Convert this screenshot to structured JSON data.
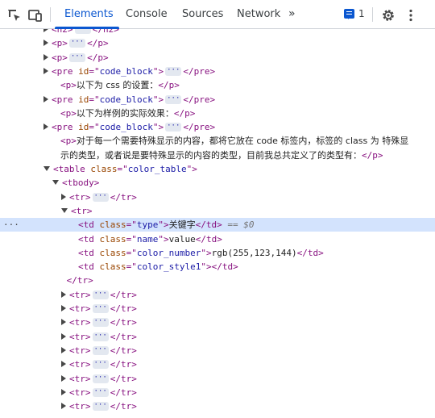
{
  "toolbar": {
    "inspect_icon": "element-picker-icon",
    "device_icon": "device-toolbar-icon",
    "tabs": [
      {
        "label": "Elements",
        "active": true
      },
      {
        "label": "Console",
        "active": false
      },
      {
        "label": "Sources",
        "active": false
      },
      {
        "label": "Network",
        "active": false
      }
    ],
    "more_tabs": "»",
    "issues_count": "1",
    "settings_icon": "gear-icon",
    "menu_icon": "kebab-menu-icon"
  },
  "tree": {
    "rows": [
      {
        "indent": 0,
        "tri": "collapsed",
        "html": "<span class='tag'>&lt;h2&gt;</span>{…}<span class='tag'>&lt;/h2&gt;</span>"
      },
      {
        "indent": 0,
        "tri": "collapsed",
        "html": "<span class='tag'>&lt;p&gt;</span>{…}<span class='tag'>&lt;/p&gt;</span>"
      },
      {
        "indent": 0,
        "tri": "collapsed",
        "html": "<span class='tag'>&lt;p&gt;</span>{…}<span class='tag'>&lt;/p&gt;</span>"
      },
      {
        "indent": 0,
        "tri": "collapsed",
        "html": "<span class='tag'>&lt;pre </span><span class='attr'>id</span><span class='tag'>=\"</span><span class='val'>code_block</span><span class='tag'>\"&gt;</span>{…}<span class='tag'>&lt;/pre&gt;</span>"
      },
      {
        "indent": 1,
        "tri": "none",
        "html": "<span class='tag'>&lt;p&gt;</span><span class='txt'>以下为 css 的设置：</span><span class='tag'>&lt;/p&gt;</span>"
      },
      {
        "indent": 0,
        "tri": "collapsed",
        "html": "<span class='tag'>&lt;pre </span><span class='attr'>id</span><span class='tag'>=\"</span><span class='val'>code_block</span><span class='tag'>\"&gt;</span>{…}<span class='tag'>&lt;/pre&gt;</span>"
      },
      {
        "indent": 1,
        "tri": "none",
        "html": "<span class='tag'>&lt;p&gt;</span><span class='txt'>以下为样例的实际效果：</span><span class='tag'>&lt;/p&gt;</span>"
      },
      {
        "indent": 0,
        "tri": "collapsed",
        "html": "<span class='tag'>&lt;pre </span><span class='attr'>id</span><span class='tag'>=\"</span><span class='val'>code_block</span><span class='tag'>\"&gt;</span>{…}<span class='tag'>&lt;/pre&gt;</span>"
      },
      {
        "indent": 1,
        "tri": "none",
        "html": "<span class='tag'>&lt;p&gt;</span><span class='txt'>对于每一个需要特殊显示的内容，都将它放在 code 标签内，标签的 class 为 特殊显</span>"
      },
      {
        "indent": 1,
        "tri": "none",
        "html": "<span class='txt'>示的类型，或者说是要特殊显示的内容的类型，目前我总共定义了的类型有：</span><span class='tag'>&lt;/p&gt;</span>"
      },
      {
        "indent": 0,
        "tri": "expanded",
        "html": "<span class='tag'>&lt;table </span><span class='attr'>class</span><span class='tag'>=\"</span><span class='val'>color_table</span><span class='tag'>\"&gt;</span>"
      },
      {
        "indent": 1,
        "tri": "expanded",
        "html": "<span class='tag'>&lt;tbody&gt;</span>"
      },
      {
        "indent": 2,
        "tri": "collapsed",
        "html": "<span class='tag'>&lt;tr&gt;</span>{…}<span class='tag'>&lt;/tr&gt;</span>"
      },
      {
        "indent": 2,
        "tri": "expanded",
        "html": "<span class='tag'>&lt;tr&gt;</span>"
      },
      {
        "indent": 3,
        "tri": "none",
        "selected": true,
        "html": "<span class='tag'>&lt;td </span><span class='attr'>class</span><span class='tag'>=\"</span><span class='val'>type</span><span class='tag'>\"&gt;</span><span class='txt'>关键字</span><span class='tag'>&lt;/td&gt;</span> <span class='dollar'>== $0</span>"
      },
      {
        "indent": 3,
        "tri": "none",
        "html": "<span class='tag'>&lt;td </span><span class='attr'>class</span><span class='tag'>=\"</span><span class='val'>name</span><span class='tag'>\"&gt;</span>value<span class='tag'>&lt;/td&gt;</span>"
      },
      {
        "indent": 3,
        "tri": "none",
        "html": "<span class='tag'>&lt;td </span><span class='attr'>class</span><span class='tag'>=\"</span><span class='val'>color_number</span><span class='tag'>\"&gt;</span>rgb(255,123,144)<span class='tag'>&lt;/td&gt;</span>"
      },
      {
        "indent": 3,
        "tri": "none",
        "html": "<span class='tag'>&lt;td </span><span class='attr'>class</span><span class='tag'>=\"</span><span class='val'>color_style1</span><span class='tag'>\"&gt;&lt;/td&gt;</span>"
      },
      {
        "indent": 2.6,
        "tri": "none",
        "html": "<span class='tag'>&lt;/tr&gt;</span>"
      },
      {
        "indent": 2,
        "tri": "collapsed",
        "html": "<span class='tag'>&lt;tr&gt;</span>{…}<span class='tag'>&lt;/tr&gt;</span>"
      },
      {
        "indent": 2,
        "tri": "collapsed",
        "html": "<span class='tag'>&lt;tr&gt;</span>{…}<span class='tag'>&lt;/tr&gt;</span>"
      },
      {
        "indent": 2,
        "tri": "collapsed",
        "html": "<span class='tag'>&lt;tr&gt;</span>{…}<span class='tag'>&lt;/tr&gt;</span>"
      },
      {
        "indent": 2,
        "tri": "collapsed",
        "html": "<span class='tag'>&lt;tr&gt;</span>{…}<span class='tag'>&lt;/tr&gt;</span>"
      },
      {
        "indent": 2,
        "tri": "collapsed",
        "html": "<span class='tag'>&lt;tr&gt;</span>{…}<span class='tag'>&lt;/tr&gt;</span>"
      },
      {
        "indent": 2,
        "tri": "collapsed",
        "html": "<span class='tag'>&lt;tr&gt;</span>{…}<span class='tag'>&lt;/tr&gt;</span>"
      },
      {
        "indent": 2,
        "tri": "collapsed",
        "html": "<span class='tag'>&lt;tr&gt;</span>{…}<span class='tag'>&lt;/tr&gt;</span>"
      },
      {
        "indent": 2,
        "tri": "collapsed",
        "html": "<span class='tag'>&lt;tr&gt;</span>{…}<span class='tag'>&lt;/tr&gt;</span>"
      },
      {
        "indent": 2,
        "tri": "collapsed",
        "html": "<span class='tag'>&lt;tr&gt;</span>{…}<span class='tag'>&lt;/tr&gt;</span>"
      }
    ],
    "selected_marker": "···"
  },
  "colors": {
    "accent": "#0b57d0",
    "tag": "#881280",
    "attr": "#994500",
    "value": "#1a1aa6",
    "selection": "#d3e3fd"
  }
}
